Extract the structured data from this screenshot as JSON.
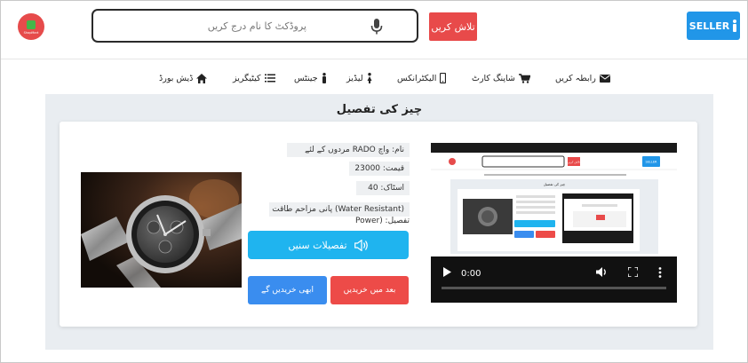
{
  "header": {
    "logo_text": "ShopMart",
    "search_placeholder": "پروڈکٹ کا نام درج کریں",
    "search_button": "تلاش کریں",
    "seller_button": "SELLER"
  },
  "nav": {
    "items": [
      {
        "label": "ڈیش بورڈ",
        "icon": "home-icon"
      },
      {
        "label": "کیٹیگریز",
        "icon": "list-icon"
      },
      {
        "label": "جینٹس",
        "icon": "male-icon"
      },
      {
        "label": "لیڈیز",
        "icon": "female-icon"
      },
      {
        "label": "الیکٹرانکس",
        "icon": "mobile-icon"
      },
      {
        "label": "شاپنگ کارٹ",
        "icon": "cart-icon"
      },
      {
        "label": "رابطہ کریں",
        "icon": "envelope-icon"
      }
    ]
  },
  "main": {
    "title": "چیز کی تفصیل"
  },
  "product": {
    "name": "نام: واچ RADO مردوں کے لئے",
    "price": "قیمت: 23000",
    "stock": "اسٹاک: 40",
    "details_line1": "(Water Resistant) پانی مزاحم طاقت",
    "details_line2": "تفصیل: (Power",
    "listen_button": "تفصیلات سنیں",
    "buy_later_button": "بعد میں خریدیں",
    "buy_now_button": "ابھی خریدیں گے"
  },
  "video": {
    "time": "0:00",
    "thumb": {
      "search_button": "تلاش کریں",
      "seller_button": "SELLER",
      "title": "چیز کی تفصیل"
    }
  },
  "colors": {
    "accent_blue": "#2196e8",
    "accent_red": "#e84a4a",
    "listen_blue": "#1fb4ef",
    "buy_now_blue": "#3a8def",
    "main_bg": "#e9edf1"
  }
}
